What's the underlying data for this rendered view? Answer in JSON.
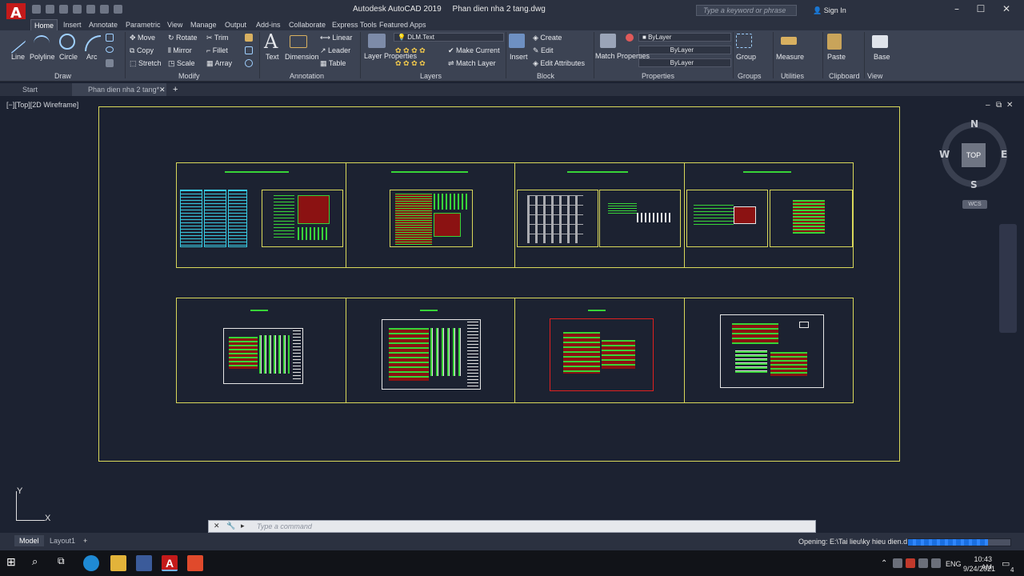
{
  "app": {
    "logo_letter": "A",
    "title": "Autodesk AutoCAD 2019",
    "filename": "Phan dien nha 2 tang.dwg",
    "search_placeholder": "Type a keyword or phrase",
    "signin_label": "Sign In"
  },
  "ribbon_tabs": [
    "Home",
    "Insert",
    "Annotate",
    "Parametric",
    "View",
    "Manage",
    "Output",
    "Add-ins",
    "Collaborate",
    "Express Tools",
    "Featured Apps"
  ],
  "ribbon": {
    "draw": {
      "label": "Draw",
      "tools": [
        "Line",
        "Polyline",
        "Circle",
        "Arc"
      ]
    },
    "modify": {
      "label": "Modify",
      "tools": [
        "Move",
        "Rotate",
        "Trim",
        "Copy",
        "Mirror",
        "Fillet",
        "Stretch",
        "Scale",
        "Array"
      ]
    },
    "annotation": {
      "label": "Annotation",
      "tools": [
        "Text",
        "Dimension",
        "Linear",
        "Leader",
        "Table"
      ]
    },
    "layers": {
      "label": "Layers",
      "layer_properties": "Layer Properties",
      "current_layer": "DLM.Text",
      "make_current": "Make Current",
      "match_layer": "Match Layer"
    },
    "block": {
      "label": "Block",
      "insert": "Insert",
      "create": "Create",
      "edit": "Edit",
      "edit_attributes": "Edit Attributes"
    },
    "properties": {
      "label": "Properties",
      "match_properties": "Match Properties",
      "color": "ByLayer",
      "linetype": "ByLayer",
      "lineweight": "ByLayer"
    },
    "groups": {
      "label": "Groups",
      "group": "Group"
    },
    "utilities": {
      "label": "Utilities",
      "measure": "Measure"
    },
    "clipboard": {
      "label": "Clipboard",
      "paste": "Paste"
    },
    "view": {
      "label": "View",
      "base": "Base"
    }
  },
  "file_tabs": [
    "Start",
    "Phan dien nha 2 tang*"
  ],
  "viewport": {
    "label": "[−][Top][2D Wireframe]",
    "compass": {
      "n": "N",
      "s": "S",
      "e": "E",
      "w": "W",
      "top": "TOP"
    },
    "wcs": "WCS"
  },
  "ucs": {
    "x": "X",
    "y": "Y"
  },
  "command_line": {
    "placeholder": "Type a command"
  },
  "layout_tabs": [
    "Model",
    "Layout1"
  ],
  "status": {
    "opening": "Opening: E:\\Tai lieu\\ky hieu dien.dwg",
    "progress": 0.78
  },
  "taskbar": {
    "time": "10:43 AM",
    "date": "9/24/2021",
    "lang": "ENG",
    "notif": "4"
  },
  "colors": {
    "accent": "#c41a1a",
    "sheet_border": "#d9d85a",
    "drawing_green": "#38d438",
    "drawing_red": "#e02020",
    "drawing_cyan": "#38c8e0"
  }
}
